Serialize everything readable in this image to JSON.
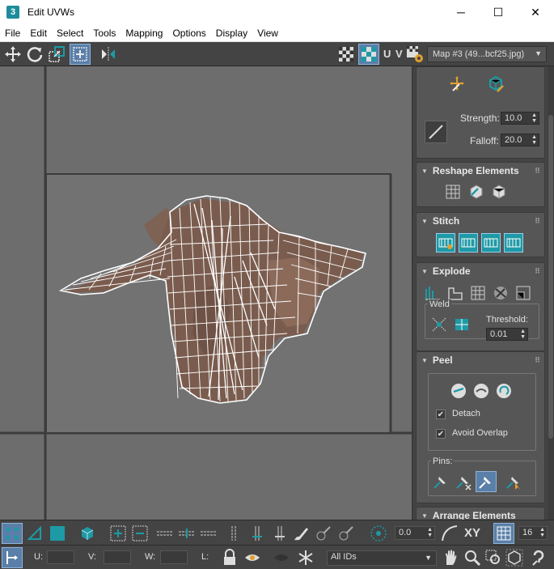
{
  "window": {
    "title": "Edit UVWs",
    "app_icon_text": "3",
    "minimize": "─",
    "maximize": "☐",
    "close": "✕"
  },
  "menu": [
    "File",
    "Edit",
    "Select",
    "Tools",
    "Mapping",
    "Options",
    "Display",
    "View"
  ],
  "toolbar": {
    "uv_label": "U V",
    "map_dropdown": "Map #3 (49...bcf25.jpg)"
  },
  "panel": {
    "strength_label": "Strength:",
    "strength_value": "10.0",
    "falloff_label": "Falloff:",
    "falloff_value": "20.0",
    "reshape_title": "Reshape Elements",
    "stitch_title": "Stitch",
    "explode_title": "Explode",
    "weld_label": "Weld",
    "threshold_label": "Threshold:",
    "threshold_value": "0.01",
    "peel_title": "Peel",
    "detach_label": "Detach",
    "detach_checked": "✔",
    "avoid_overlap_label": "Avoid Overlap",
    "avoid_overlap_checked": "✔",
    "pins_label": "Pins:",
    "arrange_title": "Arrange Elements"
  },
  "bottom": {
    "rotation_value": "0.0",
    "xy_label": "XY",
    "grid_value": "16",
    "u_label": "U:",
    "v_label": "V:",
    "w_label": "W:",
    "l_label": "L:",
    "ids_dropdown": "All IDs"
  },
  "colors": {
    "accent": "#1e9aa6",
    "selected": "#5a7fa8",
    "viewport_bg": "#6d6d6d",
    "mesh_fill": "#7d6152",
    "wire": "#ffffff"
  }
}
